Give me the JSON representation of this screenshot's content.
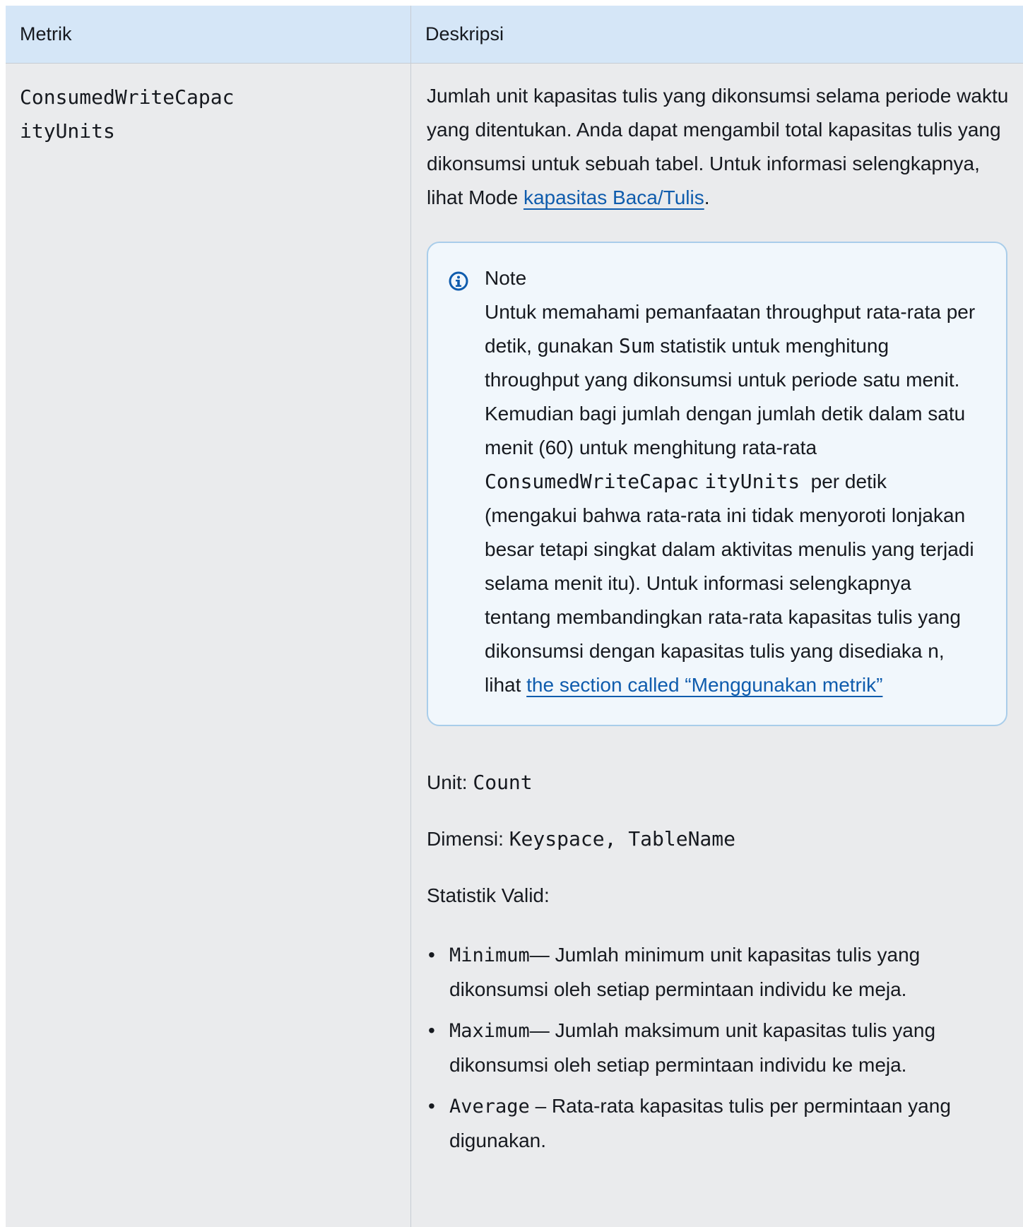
{
  "table": {
    "headers": [
      "Metrik",
      "Deskripsi"
    ]
  },
  "row": {
    "metric_line1": "ConsumedWriteCapac",
    "metric_line2": "ityUnits",
    "desc_text": "Jumlah unit kapasitas tulis yang dikonsumsi selama periode waktu yang ditentukan. Anda dapat mengambil total kapasitas tulis yang dikonsumsi untuk sebuah tabel. Untuk informasi selengkapnya, lihat Mode ",
    "desc_link": "kapasitas Baca/Tulis",
    "desc_end": ".",
    "note": {
      "icon": "info-icon",
      "title": "Note",
      "text_1": "Untuk memahami pemanfaatan throughput rata-rata per detik, gunakan ",
      "code_sum": "Sum",
      "text_2": " statistik untuk menghitung throughput yang dikonsumsi untuk periode satu menit. Kemudian bagi jumlah dengan jumlah detik dalam satu menit (60) untuk menghitung rata-rata ",
      "code_metric_1": "ConsumedWriteCapac",
      "code_metric_2": "ityUnits",
      "text_3": "  per detik (mengakui bahwa rata-rata ini tidak menyoroti lonjakan besar tetapi singkat dalam aktivitas menulis yang terjadi selama menit itu). Untuk informasi selengkapnya tentang membandingkan rata-rata kapasitas tulis yang dikonsumsi dengan kapasitas tulis yang disediaka n, lihat ",
      "link": "the section called “Menggunakan metrik”"
    },
    "unit_label": "Unit: ",
    "unit_value": "Count",
    "dim_label": "Dimensi: ",
    "dim_value": "Keyspace, TableName",
    "stats_label": "Statistik Valid:",
    "stats": [
      {
        "code": "Minimum",
        "text": "— Jumlah minimum unit kapasitas tulis yang dikonsumsi oleh setiap permintaan individu ke meja."
      },
      {
        "code": "Maximum",
        "text": "— Jumlah maksimum unit kapasitas tulis yang dikonsumsi oleh setiap permintaan individu ke meja."
      },
      {
        "code": "Average",
        "text": " – Rata-rata kapasitas tulis per permintaan yang digunakan."
      }
    ]
  },
  "colors": {
    "header_bg": "#d5e6f7",
    "row_bg": "#eaebed",
    "link": "#0f5cad",
    "note_border": "#a9cdea",
    "note_bg": "#f1f7fc",
    "info_icon": "#0f5cad"
  }
}
